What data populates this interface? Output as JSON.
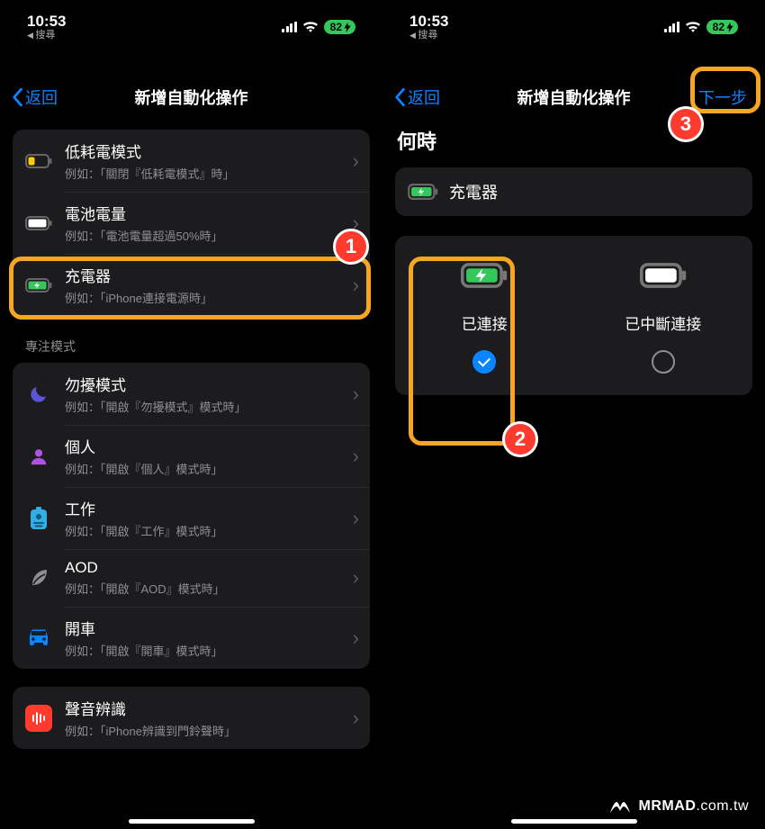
{
  "status": {
    "time": "10:53",
    "back_hint": "搜尋",
    "battery_text": "82"
  },
  "left": {
    "nav_back": "返回",
    "nav_title": "新增自動化操作",
    "group1": [
      {
        "icon": "battery-low",
        "title": "低耗電模式",
        "sub": "例如：「關閉『低耗電模式』時」"
      },
      {
        "icon": "battery-full",
        "title": "電池電量",
        "sub": "例如：「電池電量超過50%時」"
      },
      {
        "icon": "charger",
        "title": "充電器",
        "sub": "例如：「iPhone連接電源時」"
      }
    ],
    "section2_label": "專注模式",
    "group2": [
      {
        "icon": "moon",
        "title": "勿擾模式",
        "sub": "例如：「開啟『勿擾模式』模式時」"
      },
      {
        "icon": "person",
        "title": "個人",
        "sub": "例如：「開啟『個人』模式時」"
      },
      {
        "icon": "badge",
        "title": "工作",
        "sub": "例如：「開啟『工作』模式時」"
      },
      {
        "icon": "leaf",
        "title": "AOD",
        "sub": "例如：「開啟『AOD』模式時」"
      },
      {
        "icon": "car",
        "title": "開車",
        "sub": "例如：「開啟『開車』模式時」"
      }
    ],
    "group3": [
      {
        "icon": "sound",
        "title": "聲音辨識",
        "sub": "例如：「iPhone辨識到門鈴聲時」"
      }
    ]
  },
  "right": {
    "nav_back": "返回",
    "nav_title": "新增自動化操作",
    "nav_next": "下一步",
    "when_heading": "何時",
    "charger_label": "充電器",
    "options": {
      "connected": "已連接",
      "disconnected": "已中斷連接"
    }
  },
  "annotations": {
    "badge1": "1",
    "badge2": "2",
    "badge3": "3"
  },
  "watermark": {
    "brand": "MRMAD",
    "domain": ".com.tw"
  }
}
